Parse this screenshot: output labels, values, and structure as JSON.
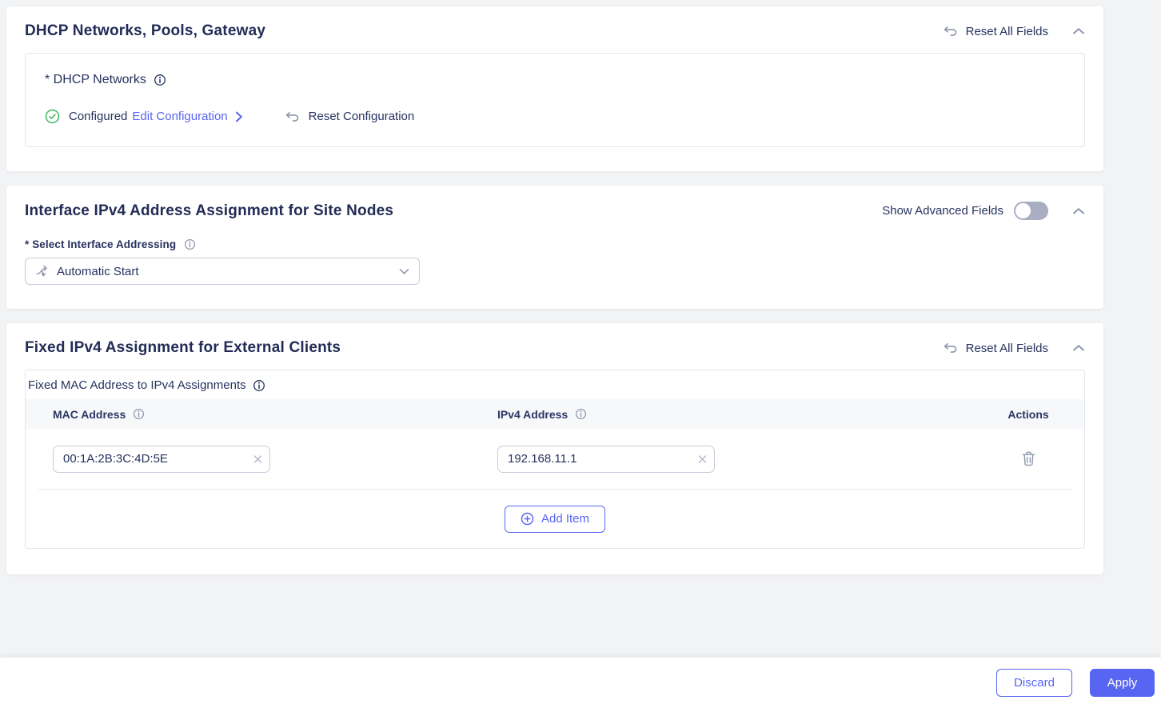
{
  "dhcp_card": {
    "title": "DHCP Networks, Pools, Gateway",
    "reset_all_label": "Reset All Fields",
    "field_label": "* DHCP Networks",
    "status_label": "Configured",
    "edit_link_label": "Edit Configuration",
    "reset_config_label": "Reset Configuration"
  },
  "interface_card": {
    "title": "Interface IPv4 Address Assignment for Site Nodes",
    "advanced_toggle_label": "Show Advanced Fields",
    "addressing_label": "* Select Interface Addressing",
    "addressing_value": "Automatic Start"
  },
  "fixed_card": {
    "title": "Fixed IPv4 Assignment for External Clients",
    "reset_all_label": "Reset All Fields",
    "table_label": "Fixed MAC Address to IPv4 Assignments",
    "columns": {
      "mac": "MAC Address",
      "ipv4": "IPv4 Address",
      "actions": "Actions"
    },
    "rows": [
      {
        "mac": "00:1A:2B:3C:4D:5E",
        "ipv4": "192.168.11.1"
      }
    ],
    "add_item_label": "Add Item"
  },
  "footer": {
    "discard_label": "Discard",
    "apply_label": "Apply"
  },
  "colors": {
    "accent": "#5865f2",
    "success": "#3bb75e",
    "navy": "#27325e",
    "toggle_off": "#a9aec2"
  }
}
